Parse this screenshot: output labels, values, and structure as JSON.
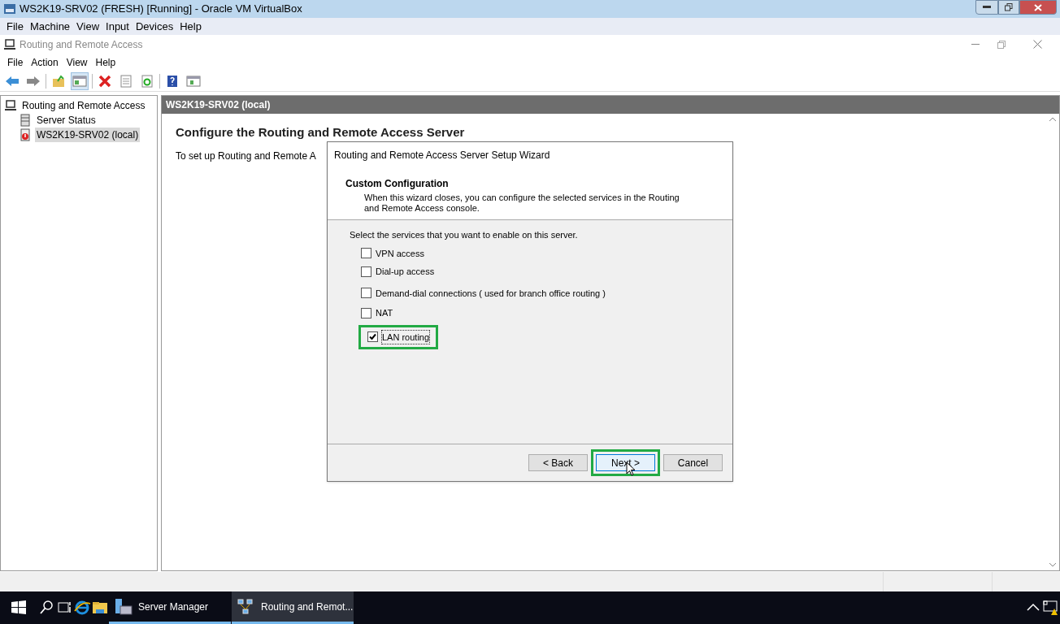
{
  "vm_window": {
    "title": "WS2K19-SRV02 (FRESH) [Running] - Oracle VM VirtualBox",
    "menu": [
      "File",
      "Machine",
      "View",
      "Input",
      "Devices",
      "Help"
    ]
  },
  "mmc": {
    "title": "Routing and Remote Access",
    "menu": [
      "File",
      "Action",
      "View",
      "Help"
    ]
  },
  "tree": [
    {
      "label": "Routing and Remote Access",
      "selected": false,
      "children": [
        {
          "label": "Server Status",
          "selected": false
        },
        {
          "label": "WS2K19-SRV02 (local)",
          "selected": true
        }
      ]
    }
  ],
  "pane": {
    "header": "WS2K19-SRV02 (local)",
    "heading": "Configure the Routing and Remote Access Server",
    "text": "To set up Routing and Remote A"
  },
  "wizard": {
    "title": "Routing and Remote Access Server Setup Wizard",
    "heading": "Custom Configuration",
    "description": "When this wizard closes, you can configure the selected services in the Routing and Remote Access console.",
    "prompt": "Select the services that you want to enable on this server.",
    "options": [
      {
        "label": "VPN access",
        "checked": false,
        "highlighted": false
      },
      {
        "label": "Dial-up access",
        "checked": false,
        "highlighted": false
      },
      {
        "label": "Demand-dial connections ( used for branch office routing )",
        "checked": false,
        "highlighted": false
      },
      {
        "label": "NAT",
        "checked": false,
        "highlighted": false
      },
      {
        "label": "LAN routing",
        "checked": true,
        "highlighted": true
      }
    ],
    "buttons": [
      {
        "label": "< Back",
        "highlighted": false
      },
      {
        "label": "Next >",
        "highlighted": true
      },
      {
        "label": "Cancel",
        "highlighted": false
      }
    ]
  },
  "taskbar": {
    "apps": [
      {
        "label": "Server Manager",
        "selected": false
      },
      {
        "label": "Routing and Remot...",
        "selected": true
      }
    ]
  }
}
